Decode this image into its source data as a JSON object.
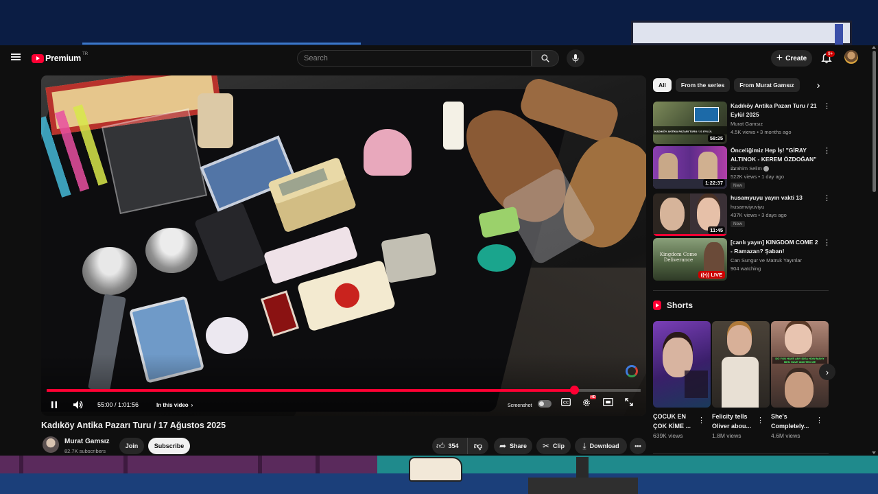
{
  "header": {
    "brand": "Premium",
    "brand_suffix": "TR",
    "search_placeholder": "Search",
    "create_label": "Create",
    "notification_count": "9+"
  },
  "player": {
    "time": "55:00 / 1:01:56",
    "progress_fraction": 0.888,
    "chapter_label": "In this video",
    "screenshot_label": "Screenshot",
    "settings_badge": "HD"
  },
  "video": {
    "title": "Kadıköy Antika Pazarı Turu / 17 Ağustos 2025",
    "channel": "Murat Gamsız",
    "subscribers": "82.7K subscribers",
    "join_label": "Join",
    "subscribe_label": "Subscribe",
    "likes": "354",
    "share_label": "Share",
    "clip_label": "Clip",
    "download_label": "Download"
  },
  "sidebar": {
    "chips": [
      {
        "label": "All",
        "active": true
      },
      {
        "label": "From the series",
        "active": false
      },
      {
        "label": "From Murat Gamsız",
        "active": false
      }
    ],
    "recommendations": [
      {
        "title": "Kadıköy Antika Pazarı Turu / 21 Eylül 2025",
        "channel": "Murat Gamsız",
        "stats": "4.5K views • 3 months ago",
        "duration": "58:25",
        "thumb_overlay": "KADIKÖY ANTİKA PAZARI TURU / 21 EYLÜL",
        "thumb_color": "#5f6e48"
      },
      {
        "title": "Önceliğimiz Hep İş! \"GİRAY ALTINOK - KEREM ÖZDOĞAN\" ...",
        "channel": "İbrahim Selim",
        "stats": "522K views • 1 day ago",
        "duration": "1:22:37",
        "badge": "New",
        "thumb_color": "#6b2d8c"
      },
      {
        "title": "husamyuyu yayın vakti 13",
        "channel": "husamviyuviyu",
        "stats": "437K views • 3 days ago",
        "duration": "11:45",
        "badge": "New",
        "thumb_color": "#3a2f2a"
      },
      {
        "title": "[canlı yayın] KINGDOM COME 2 - Ramazan? Şaban!",
        "channel": "Can Sungur ve Matruk Yayınlar",
        "stats": "904 watching",
        "live_label": "LIVE",
        "thumb_overlay": "Kingdom Come Deliverance",
        "thumb_color": "#4a5a3a"
      }
    ],
    "shorts_title": "Shorts",
    "shorts": [
      {
        "title": "ÇOCUK EN ÇOK KİME ...",
        "views": "639K views",
        "thumb_color": "#4a2a6a"
      },
      {
        "title": "Felicity tells Oliver abou...",
        "views": "1.8M views",
        "thumb_color": "#3a3530"
      },
      {
        "title": "She's Completely...",
        "views": "4.6M views",
        "thumb_color": "#6a5048",
        "overlay": "DO YOU HAVE ANY IDEA HOW MANY MEN HAVE WANTED ME"
      }
    ]
  }
}
